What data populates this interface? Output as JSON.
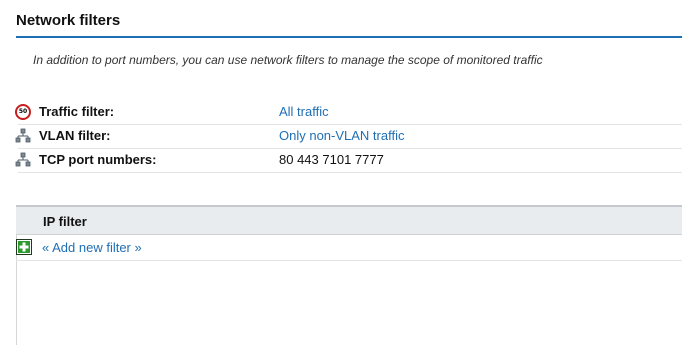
{
  "section": {
    "title": "Network filters",
    "description": "In addition to port numbers, you can use network filters to manage the scope of monitored traffic"
  },
  "filters": [
    {
      "label": "Traffic filter:",
      "value": "All traffic",
      "icon": "speed-limit-icon",
      "icon_text": "50",
      "is_link": true
    },
    {
      "label": "VLAN filter:",
      "value": "Only non-VLAN traffic",
      "icon": "network-icon",
      "is_link": true
    },
    {
      "label": "TCP port numbers:",
      "value": "80 443 7101 7777",
      "icon": "network-icon",
      "is_link": false
    }
  ],
  "ip_filter_table": {
    "header": "IP filter",
    "add_label": "« Add new filter »",
    "add_icon": "add-icon"
  },
  "colors": {
    "link": "#1f6fb5",
    "header_rule": "#1f6fb5",
    "speed_sign_ring": "#c81e1e",
    "add_icon_green": "#2e9a2e",
    "table_header_bg": "#e9ecef"
  }
}
